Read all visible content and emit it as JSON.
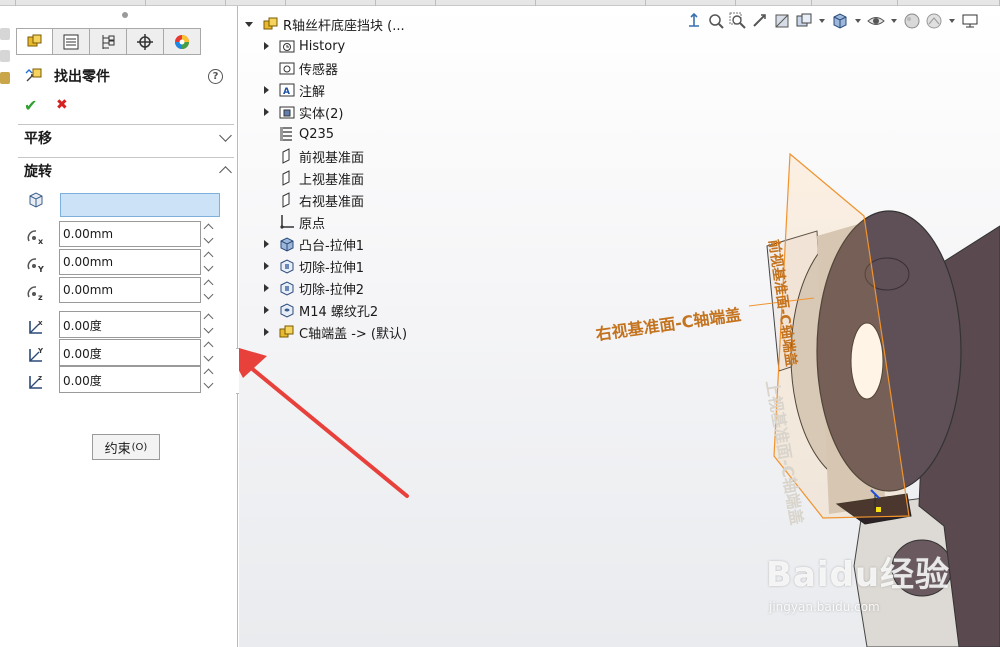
{
  "property_manager": {
    "title": "找出零件",
    "help": "?",
    "ok": "✔",
    "cancel": "✖",
    "sections": {
      "translate": "平移",
      "rotate": "旋转"
    },
    "translate_fields": [
      {
        "axis": "X",
        "value": "0.00mm"
      },
      {
        "axis": "Y",
        "value": "0.00mm"
      },
      {
        "axis": "Z",
        "value": "0.00mm"
      }
    ],
    "rotate_fields": [
      {
        "axis": "X",
        "value": "0.00度"
      },
      {
        "axis": "Y",
        "value": "0.00度"
      },
      {
        "axis": "Z",
        "value": "0.00度"
      }
    ],
    "constraint_button": "约束",
    "constraint_shortcut": "(O)"
  },
  "feature_tree": {
    "root": "R轴丝杆底座挡块 (...",
    "items": [
      {
        "label": "History",
        "expandable": true
      },
      {
        "label": "传感器",
        "expandable": false
      },
      {
        "label": "注解",
        "expandable": true
      },
      {
        "label": "实体(2)",
        "expandable": true
      },
      {
        "label": "Q235",
        "expandable": false
      },
      {
        "label": "前视基准面",
        "expandable": false
      },
      {
        "label": "上视基准面",
        "expandable": false
      },
      {
        "label": "右视基准面",
        "expandable": false
      },
      {
        "label": "原点",
        "expandable": false
      },
      {
        "label": "凸台-拉伸1",
        "expandable": true
      },
      {
        "label": "切除-拉伸1",
        "expandable": true
      },
      {
        "label": "切除-拉伸2",
        "expandable": true
      },
      {
        "label": "M14 螺纹孔2",
        "expandable": true
      },
      {
        "label": "C轴端盖 -> (默认)",
        "expandable": true
      }
    ]
  },
  "viewport": {
    "annotations": {
      "right_plane": "右视基准面-C轴端盖",
      "top_plane": "上视基准面-C轴端盖",
      "front_plane": "前视基准面-C轴端盖"
    },
    "watermark": "Baidu经验",
    "watermark_url": "jingyan.baidu.com"
  },
  "colors": {
    "accent": "#cce3f7",
    "annotation": "#c4731f",
    "arrow": "#e8403a",
    "part_dark": "#5a4a50",
    "part_light": "#d9d6d2"
  }
}
